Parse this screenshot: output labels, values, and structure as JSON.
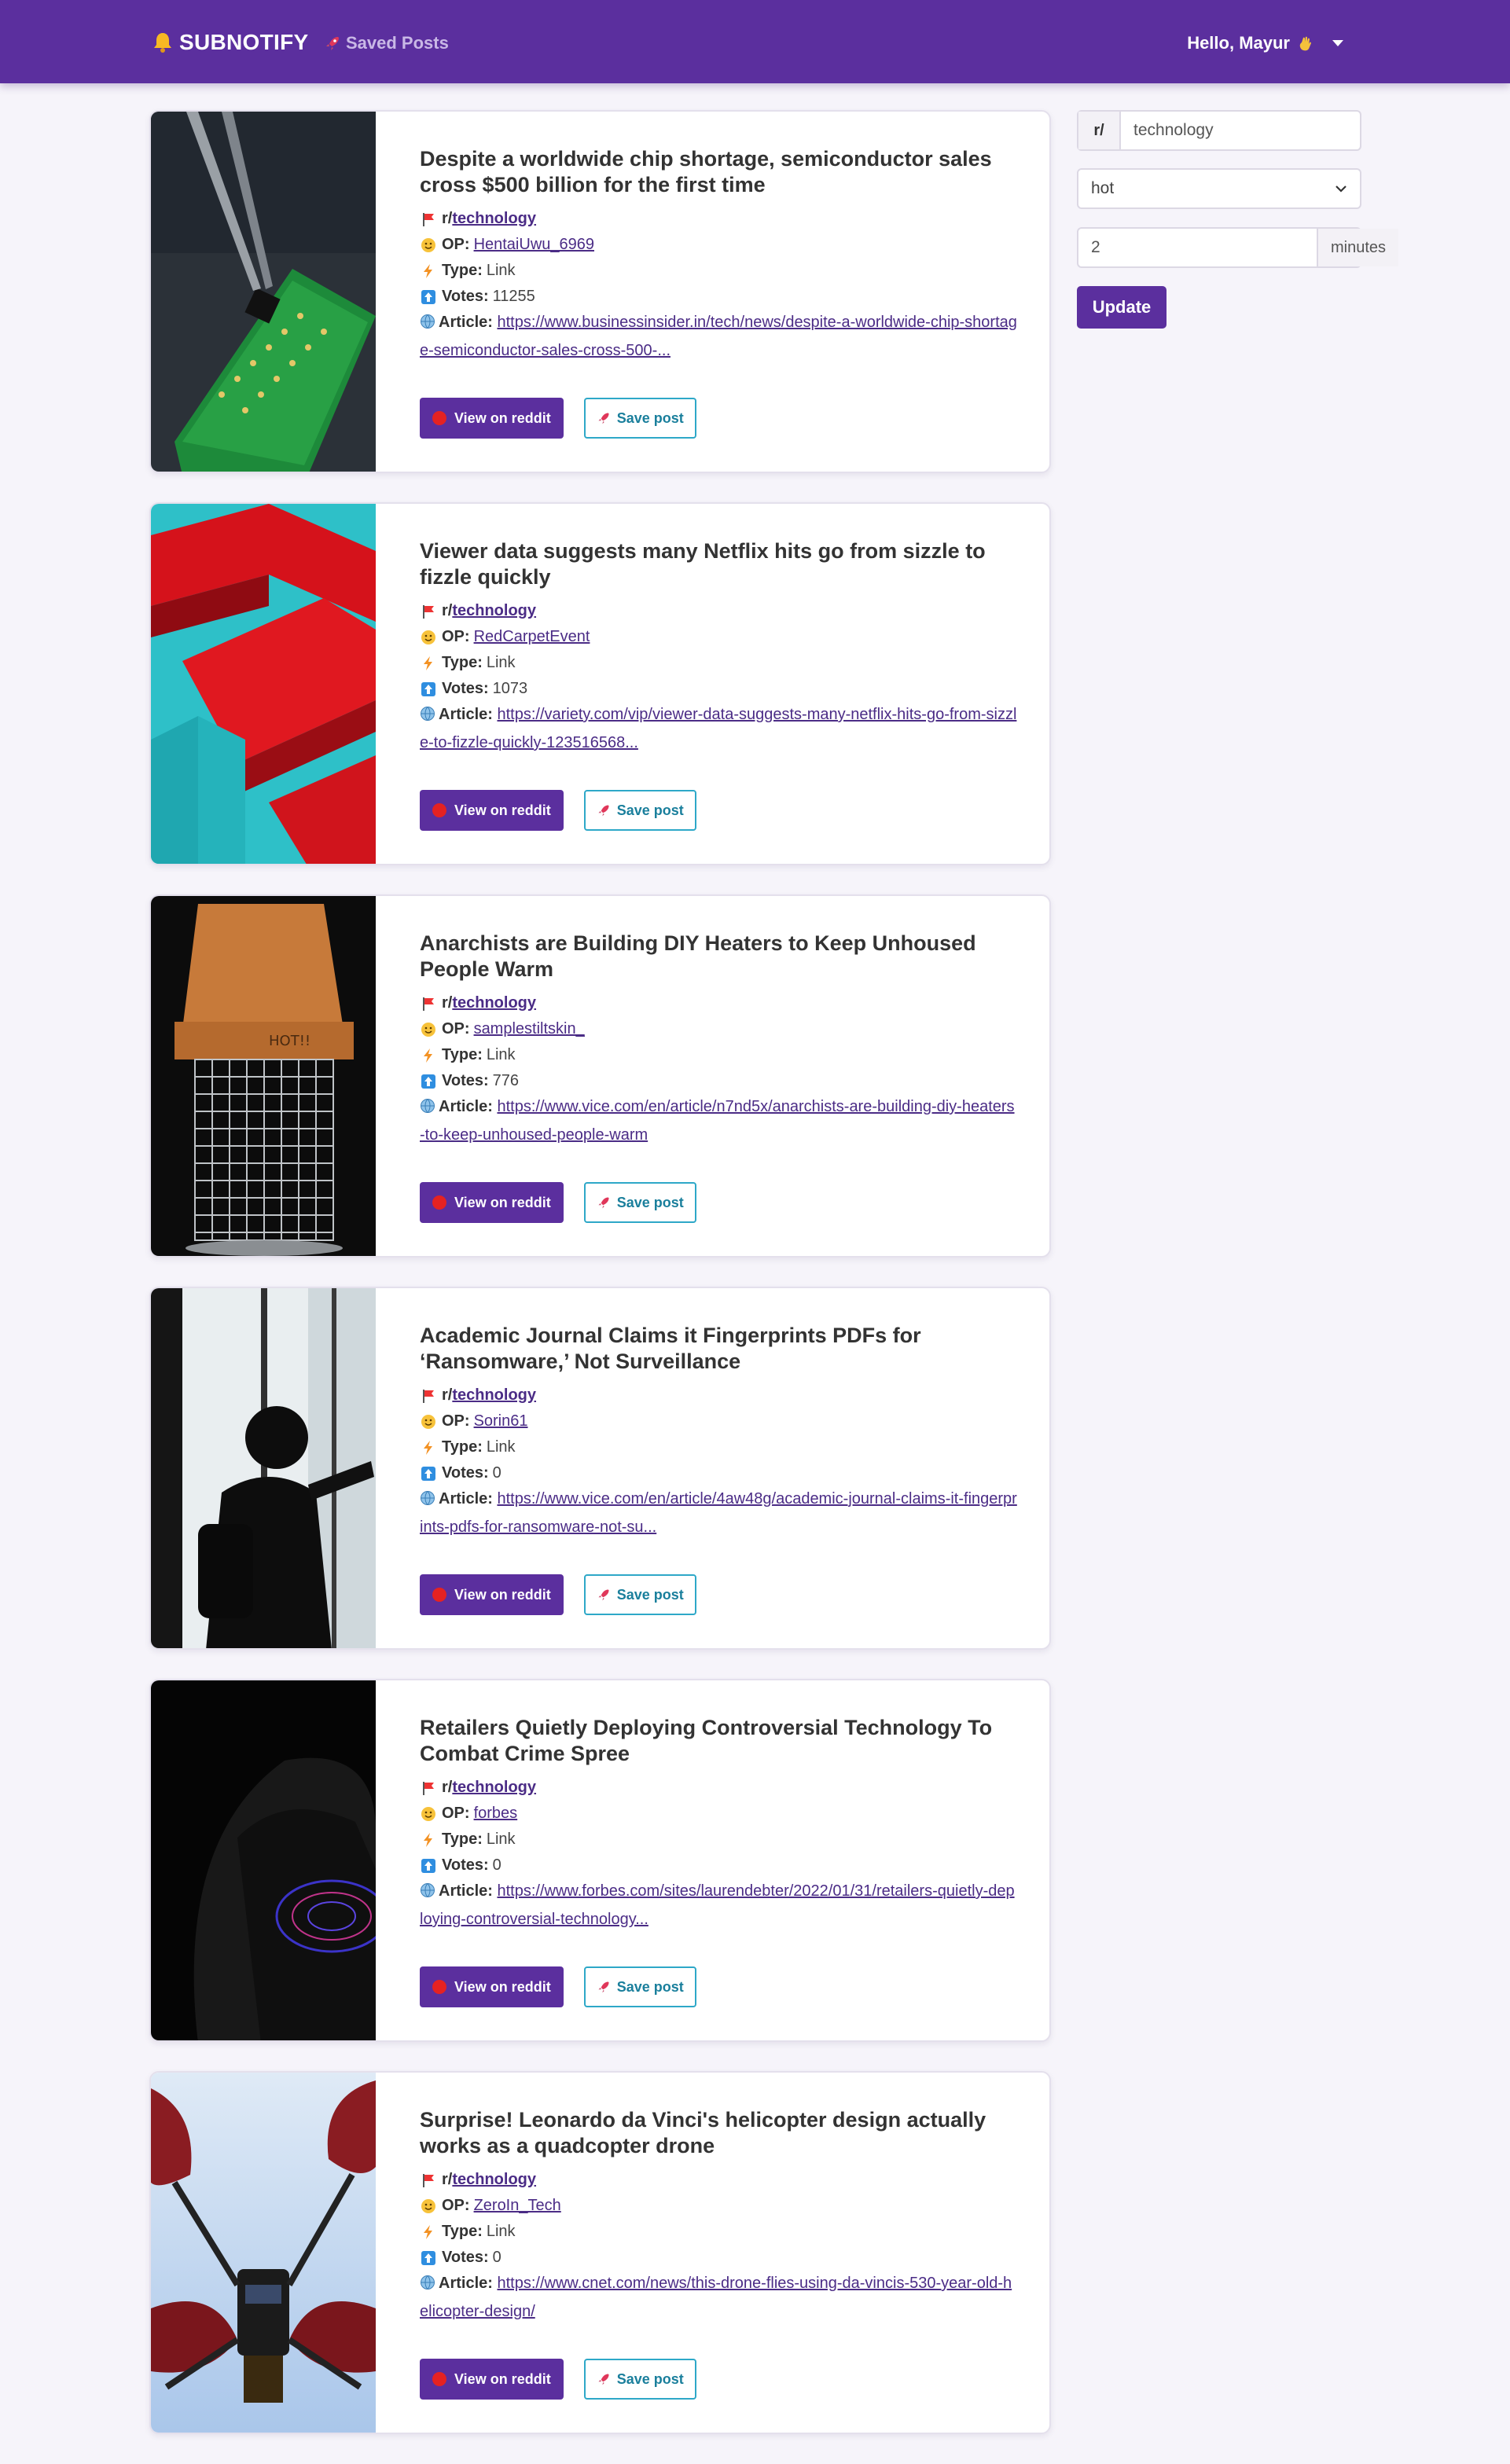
{
  "nav": {
    "brand": "SUBNOTIFY",
    "saved_posts": "Saved Posts",
    "greeting": "Hello, Mayur"
  },
  "form": {
    "subreddit_prefix": "r/",
    "subreddit_value": "technology",
    "sort_value": "hot",
    "interval_value": "2",
    "interval_unit": "minutes",
    "update_label": "Update"
  },
  "labels": {
    "op": "OP:",
    "type": "Type:",
    "votes": "Votes:",
    "article": "Article:",
    "view_button": "View on reddit",
    "save_button": "Save post"
  },
  "posts": [
    {
      "title": "Despite a worldwide chip shortage, semiconductor sales cross $500 billion for the first time",
      "subreddit_prefix": "r/",
      "subreddit": "technology",
      "op": "HentaiUwu_6969",
      "type": "Link",
      "votes": "11255",
      "article_url": "https://www.businessinsider.in/tech/news/despite-a-worldwide-chip-shortage-semiconductor-sales-cross-500-..."
    },
    {
      "title": "Viewer data suggests many Netflix hits go from sizzle to fizzle quickly",
      "subreddit_prefix": "r/",
      "subreddit": "technology",
      "op": "RedCarpetEvent",
      "type": "Link",
      "votes": "1073",
      "article_url": "https://variety.com/vip/viewer-data-suggests-many-netflix-hits-go-from-sizzle-to-fizzle-quickly-123516568..."
    },
    {
      "title": "Anarchists are Building DIY Heaters to Keep Unhoused People Warm",
      "subreddit_prefix": "r/",
      "subreddit": "technology",
      "op": "samplestiltskin_",
      "type": "Link",
      "votes": "776",
      "article_url": "https://www.vice.com/en/article/n7nd5x/anarchists-are-building-diy-heaters-to-keep-unhoused-people-warm"
    },
    {
      "title": "Academic Journal Claims it Fingerprints PDFs for ‘Ransomware,’ Not Surveillance",
      "subreddit_prefix": "r/",
      "subreddit": "technology",
      "op": "Sorin61",
      "type": "Link",
      "votes": "0",
      "article_url": "https://www.vice.com/en/article/4aw48g/academic-journal-claims-it-fingerprints-pdfs-for-ransomware-not-su..."
    },
    {
      "title": "Retailers Quietly Deploying Controversial Technology To Combat Crime Spree",
      "subreddit_prefix": "r/",
      "subreddit": "technology",
      "op": "forbes",
      "type": "Link",
      "votes": "0",
      "article_url": "https://www.forbes.com/sites/laurendebter/2022/01/31/retailers-quietly-deploying-controversial-technology..."
    },
    {
      "title": "Surprise! Leonardo da Vinci's helicopter design actually works as a quadcopter drone",
      "subreddit_prefix": "r/",
      "subreddit": "technology",
      "op": "ZeroIn_Tech",
      "type": "Link",
      "votes": "0",
      "article_url": "https://www.cnet.com/news/this-drone-flies-using-da-vincis-530-year-old-helicopter-design/"
    }
  ],
  "colors": {
    "nav_bg": "#5b2f9e",
    "page_bg": "#f6f4fa",
    "primary_button": "#5b2f9e",
    "save_button_border": "#2ea8c8",
    "link": "#4b2c86"
  },
  "icons": [
    "bell-icon",
    "rocket-icon",
    "waving-hand-icon",
    "red-flag-icon",
    "smiley-icon",
    "lightning-icon",
    "up-arrow-icon",
    "globe-icon",
    "red-dot-icon",
    "chevron-down-icon"
  ]
}
